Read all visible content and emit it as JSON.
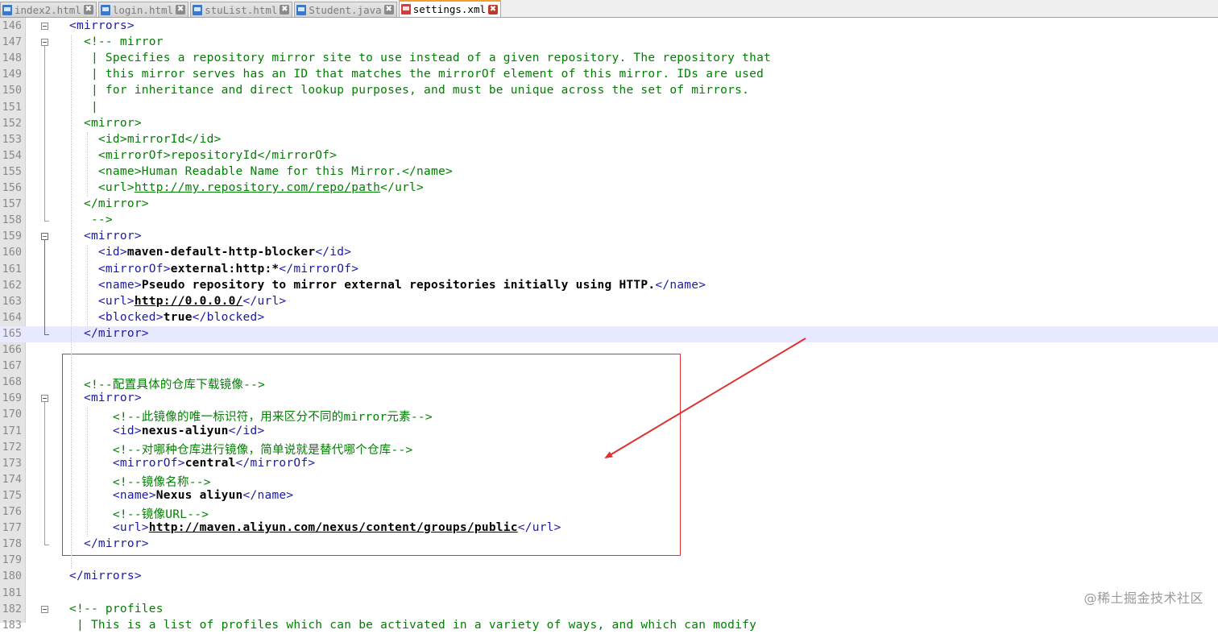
{
  "tabs": [
    {
      "label": "index2.html",
      "active": false
    },
    {
      "label": "login.html",
      "active": false
    },
    {
      "label": "stuList.html",
      "active": false
    },
    {
      "label": "Student.java",
      "active": false
    },
    {
      "label": "settings.xml",
      "active": true
    }
  ],
  "close_glyph": "✖",
  "current_line": 165,
  "lines": [
    {
      "n": "146",
      "parts": [
        [
          "tag",
          "<mirrors>"
        ]
      ]
    },
    {
      "n": "147",
      "parts": [
        [
          "comment",
          "  <!-- mirror"
        ]
      ]
    },
    {
      "n": "148",
      "parts": [
        [
          "comment",
          "   | Specifies a repository mirror site to use instead of a given repository. The repository that"
        ]
      ]
    },
    {
      "n": "149",
      "parts": [
        [
          "comment",
          "   | this mirror serves has an ID that matches the mirrorOf element of this mirror. IDs are used"
        ]
      ]
    },
    {
      "n": "150",
      "parts": [
        [
          "comment",
          "   | for inheritance and direct lookup purposes, and must be unique across the set of mirrors."
        ]
      ]
    },
    {
      "n": "151",
      "parts": [
        [
          "comment",
          "   |"
        ]
      ]
    },
    {
      "n": "152",
      "parts": [
        [
          "comment",
          "  <mirror>"
        ]
      ]
    },
    {
      "n": "153",
      "parts": [
        [
          "comment",
          "    <id>mirrorId</id>"
        ]
      ]
    },
    {
      "n": "154",
      "parts": [
        [
          "comment",
          "    <mirrorOf>repositoryId</mirrorOf>"
        ]
      ]
    },
    {
      "n": "155",
      "parts": [
        [
          "comment",
          "    <name>Human Readable Name for this Mirror.</name>"
        ]
      ]
    },
    {
      "n": "156",
      "parts": [
        [
          "comment",
          "    <url>"
        ],
        [
          "linkg",
          "http://my.repository.com/repo/path"
        ],
        [
          "comment",
          "</url>"
        ]
      ]
    },
    {
      "n": "157",
      "parts": [
        [
          "comment",
          "  </mirror>"
        ]
      ]
    },
    {
      "n": "158",
      "parts": [
        [
          "comment",
          "   -->"
        ]
      ]
    },
    {
      "n": "159",
      "parts": [
        [
          "tag",
          "  <mirror>"
        ]
      ]
    },
    {
      "n": "160",
      "parts": [
        [
          "tag",
          "    <id>"
        ],
        [
          "bold",
          "maven-default-http-blocker"
        ],
        [
          "tag",
          "</id>"
        ]
      ]
    },
    {
      "n": "161",
      "parts": [
        [
          "tag",
          "    <mirrorOf>"
        ],
        [
          "bold",
          "external:http:*"
        ],
        [
          "tag",
          "</mirrorOf>"
        ]
      ]
    },
    {
      "n": "162",
      "parts": [
        [
          "tag",
          "    <name>"
        ],
        [
          "bold",
          "Pseudo repository to mirror external repositories initially using HTTP."
        ],
        [
          "tag",
          "</name>"
        ]
      ]
    },
    {
      "n": "163",
      "parts": [
        [
          "tag",
          "    <url>"
        ],
        [
          "link",
          "http://0.0.0.0/"
        ],
        [
          "tag",
          "</url>"
        ]
      ]
    },
    {
      "n": "164",
      "parts": [
        [
          "tag",
          "    <blocked>"
        ],
        [
          "bold",
          "true"
        ],
        [
          "tag",
          "</blocked>"
        ]
      ]
    },
    {
      "n": "165",
      "parts": [
        [
          "tag",
          "  </mirror>"
        ]
      ]
    },
    {
      "n": "166",
      "parts": []
    },
    {
      "n": "167",
      "parts": []
    },
    {
      "n": "168",
      "parts": [
        [
          "comment",
          "  <!--配置具体的仓库下载镜像-->"
        ]
      ]
    },
    {
      "n": "169",
      "parts": [
        [
          "tag",
          "  <mirror>"
        ]
      ]
    },
    {
      "n": "170",
      "parts": [
        [
          "comment",
          "      <!--此镜像的唯一标识符，用来区分不同的mirror元素-->"
        ]
      ]
    },
    {
      "n": "171",
      "parts": [
        [
          "tag",
          "      <id>"
        ],
        [
          "bold",
          "nexus-aliyun"
        ],
        [
          "tag",
          "</id>"
        ]
      ]
    },
    {
      "n": "172",
      "parts": [
        [
          "comment",
          "      <!--对哪种仓库进行镜像，简单说就是替代哪个仓库-->"
        ]
      ]
    },
    {
      "n": "173",
      "parts": [
        [
          "tag",
          "      <mirrorOf>"
        ],
        [
          "bold",
          "central"
        ],
        [
          "tag",
          "</mirrorOf>"
        ]
      ]
    },
    {
      "n": "174",
      "parts": [
        [
          "comment",
          "      <!--镜像名称-->"
        ]
      ]
    },
    {
      "n": "175",
      "parts": [
        [
          "tag",
          "      <name>"
        ],
        [
          "bold",
          "Nexus aliyun"
        ],
        [
          "tag",
          "</name>"
        ]
      ]
    },
    {
      "n": "176",
      "parts": [
        [
          "comment",
          "      <!--镜像URL-->"
        ]
      ]
    },
    {
      "n": "177",
      "parts": [
        [
          "tag",
          "      <url>"
        ],
        [
          "link",
          "http://maven.aliyun.com/nexus/content/groups/public"
        ],
        [
          "tag",
          "</url>"
        ]
      ]
    },
    {
      "n": "178",
      "parts": [
        [
          "tag",
          "  </mirror>"
        ]
      ]
    },
    {
      "n": "179",
      "parts": []
    },
    {
      "n": "180",
      "parts": [
        [
          "tag",
          "</mirrors>"
        ]
      ]
    },
    {
      "n": "181",
      "parts": []
    },
    {
      "n": "182",
      "parts": [
        [
          "comment",
          "<!-- profiles"
        ]
      ]
    },
    {
      "n": "183",
      "parts": [
        [
          "comment",
          " | This is a list of profiles which can be activated in a variety of ways, and which can modify"
        ]
      ]
    }
  ],
  "colors": {
    "tag": "#1a1aa6",
    "comment": "#008000",
    "annotation": "#e03030"
  },
  "watermark": "@稀土掘金技术社区"
}
